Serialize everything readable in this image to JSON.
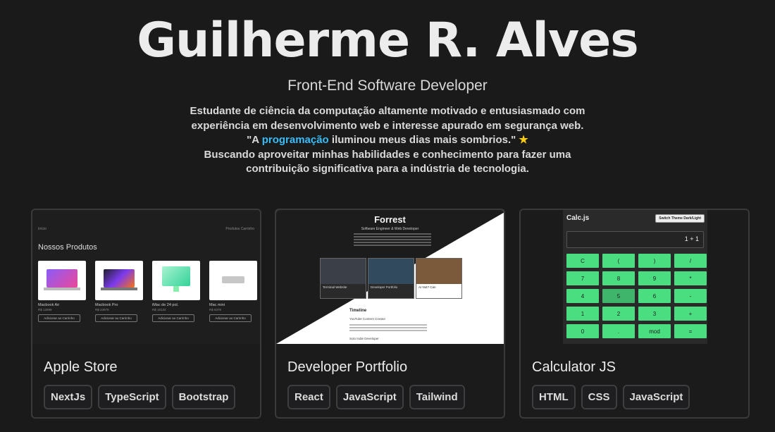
{
  "hero": {
    "name": "Guilherme R. Alves",
    "subtitle": "Front-End Software Developer",
    "bio_line1": "Estudante de ciência da computação altamente motivado e entusiasmado com experiência em desenvolvimento web e interesse apurado em segurança web.",
    "quote_open": "\"A ",
    "quote_highlight": "programação",
    "quote_rest": " iluminou meus dias mais sombrios.\"",
    "star": "★",
    "bio_line2": "Buscando aproveitar minhas habilidades e conhecimento para fazer uma contribuição significativa para a indústria de tecnologia."
  },
  "projects": [
    {
      "title": "Apple Store",
      "tags": [
        "NextJs",
        "TypeScript",
        "Bootstrap"
      ],
      "preview": {
        "topbar_left": "Início",
        "topbar_right": "Produtos  Carrinho",
        "heading": "Nossos Produtos",
        "items": [
          {
            "name": "Macbook Air",
            "price": "R$ 12599",
            "button": "Adicionar ao Carrinho"
          },
          {
            "name": "Macbook Pro",
            "price": "R$ 23979",
            "button": "Adicionar ao Carrinho"
          },
          {
            "name": "iMac de 24 pol.",
            "price": "R$ 18134",
            "button": "Adicionar ao Carrinho"
          },
          {
            "name": "Mac mini",
            "price": "R$ 8378",
            "button": "Adicionar ao Carrinho"
          }
        ]
      }
    },
    {
      "title": "Developer Portfolio",
      "tags": [
        "React",
        "JavaScript",
        "Tailwind"
      ],
      "preview": {
        "name": "Forrest",
        "role": "Software Engineer & Web Developer",
        "cards": [
          "Terminal Website",
          "Developer Portfolio",
          "AI Not? Can"
        ],
        "timeline": "Timeline",
        "timeline_item1": "YouTube Content Creator",
        "timeline_item2": "Solo Indie Developer"
      }
    },
    {
      "title": "Calculator JS",
      "tags": [
        "HTML",
        "CSS",
        "JavaScript"
      ],
      "preview": {
        "title": "Calc.js",
        "switch": "Switch Theme Dark/Light",
        "display": "1 + 1",
        "keys": [
          "C",
          "(",
          ")",
          "/",
          "7",
          "8",
          "9",
          "*",
          "4",
          "5",
          "6",
          "-",
          "1",
          "2",
          "3",
          "+",
          "0",
          ".",
          "mod",
          "="
        ]
      }
    }
  ]
}
